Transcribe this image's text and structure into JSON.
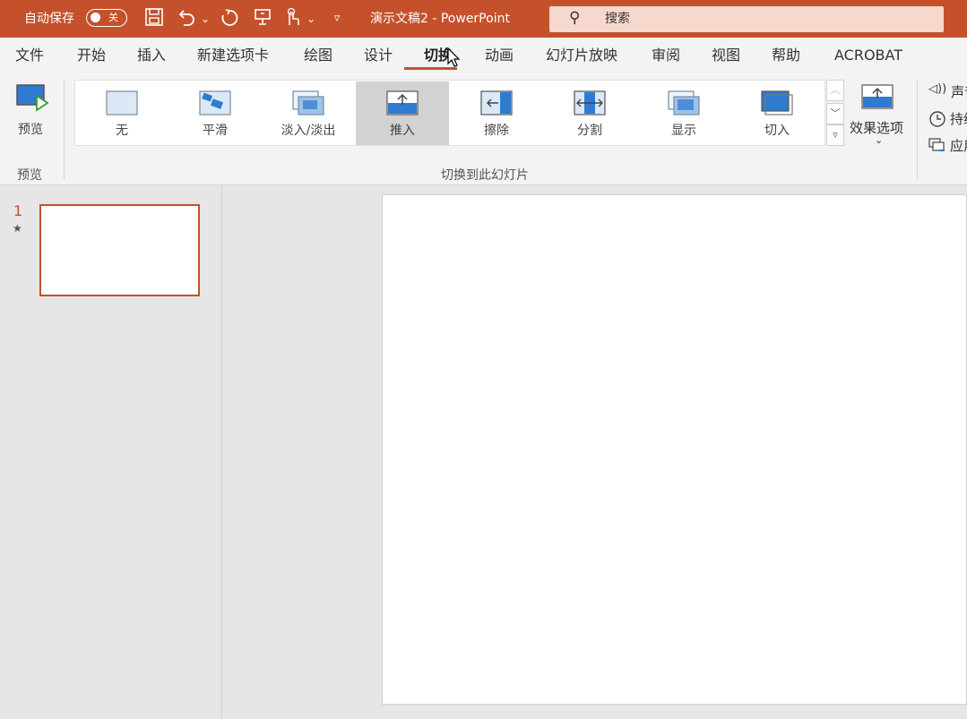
{
  "title_bar": {
    "autosave_label": "自动保存",
    "autosave_state": "关",
    "doc_title": "演示文稿2  -  PowerPoint",
    "search_placeholder": "搜索",
    "quick_access_icons": [
      "save-icon",
      "undo-icon",
      "redo-icon",
      "present-icon",
      "touch-mode-icon",
      "customize-icon"
    ]
  },
  "tabs": [
    {
      "label": "文件"
    },
    {
      "label": "开始"
    },
    {
      "label": "插入"
    },
    {
      "label": "新建选项卡"
    },
    {
      "label": "绘图"
    },
    {
      "label": "设计"
    },
    {
      "label": "切换",
      "active": true
    },
    {
      "label": "动画"
    },
    {
      "label": "幻灯片放映"
    },
    {
      "label": "审阅"
    },
    {
      "label": "视图"
    },
    {
      "label": "帮助"
    },
    {
      "label": "ACROBAT"
    }
  ],
  "ribbon": {
    "preview_button": "预览",
    "preview_group": "预览",
    "transitions": [
      {
        "label": "无"
      },
      {
        "label": "平滑"
      },
      {
        "label": "淡入/淡出"
      },
      {
        "label": "推入",
        "selected": true
      },
      {
        "label": "擦除"
      },
      {
        "label": "分割"
      },
      {
        "label": "显示"
      },
      {
        "label": "切入"
      }
    ],
    "transitions_group": "切换到此幻灯片",
    "effect_options": "效果选项",
    "timing": {
      "sound": "声音",
      "duration": "持续",
      "apply": "应用"
    }
  },
  "slides": [
    {
      "number": "1",
      "has_animation_star": true
    }
  ],
  "colors": {
    "accent": "#c4512c",
    "selected_bg": "#d2d2d2",
    "icon_blue": "#2f7bd0"
  }
}
